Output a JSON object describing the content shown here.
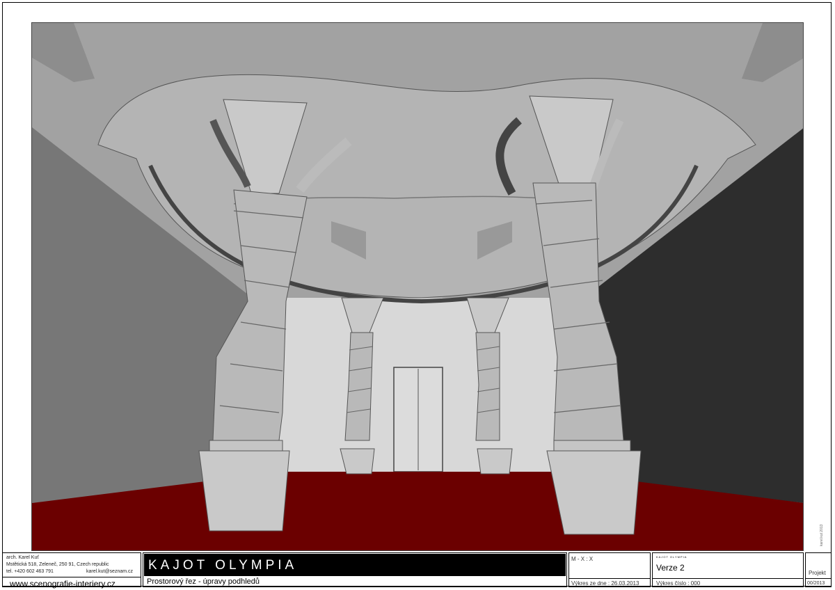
{
  "architect": {
    "name": "arch. Karel Kuť",
    "address": "Mstětická 518, Zeleneč, 250 91, Czech republic",
    "phone": "tel. +420 602 463 791",
    "email": "karel.kut@seznam.cz",
    "website": "www.scenografie-interiery.cz"
  },
  "project": {
    "title": "KAJOT OLYMPIA",
    "subtitle": "Prostorový řez - úpravy podhledů",
    "scale": "M - X : X",
    "drawing_date": "Výkres ze dne : 26.03.2013",
    "client_small": "KAJOT OLYMPIA",
    "version": "Verze 2",
    "drawing_number": "Výkres číslo : 000",
    "project_label": "Projekt",
    "project_number": "00/2013"
  },
  "side_mark": "karel.kut 2013",
  "colors": {
    "floor": "#6b0000",
    "wall_right": "#2b2b2b",
    "wall_left": "#767676",
    "ceiling": "#9d9d9d",
    "back_wall": "#d6d6d6",
    "column": "#b8b8b8"
  }
}
